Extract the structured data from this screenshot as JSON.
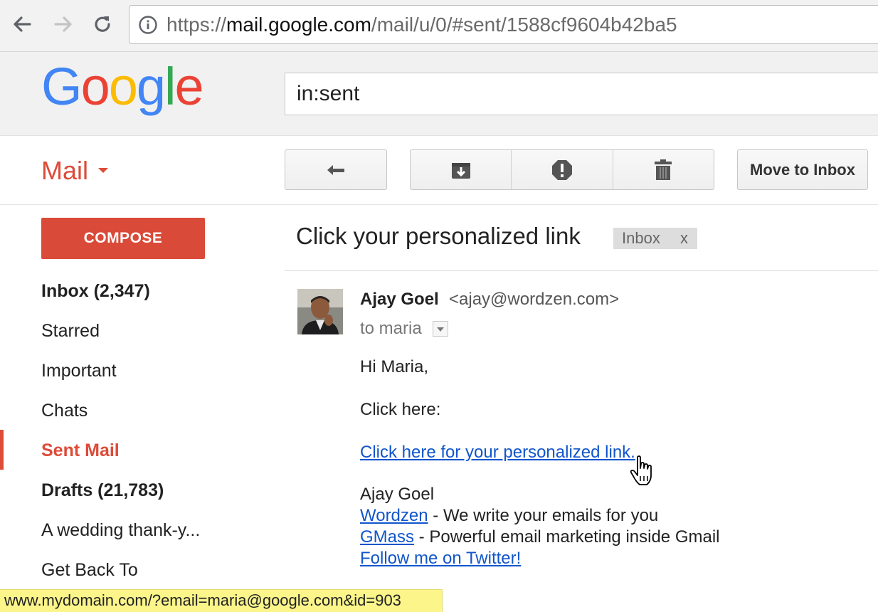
{
  "browser": {
    "url_prefix": "https://",
    "url_host": "mail.google.com",
    "url_path": "/mail/u/0/#sent/1588cf9604b42ba5"
  },
  "gmail": {
    "logo_letters": [
      {
        "ch": "G",
        "color": "#4285f4"
      },
      {
        "ch": "o",
        "color": "#ea4335"
      },
      {
        "ch": "o",
        "color": "#fbbc05"
      },
      {
        "ch": "g",
        "color": "#4285f4"
      },
      {
        "ch": "l",
        "color": "#34a853"
      },
      {
        "ch": "e",
        "color": "#ea4335"
      }
    ],
    "search_value": "in:sent",
    "app_label": "Mail"
  },
  "toolbar": {
    "reply_icon": "reply-icon",
    "archive_icon": "archive-icon",
    "spam_icon": "report-spam-icon",
    "delete_icon": "trash-icon",
    "move_label": "Move to Inbox"
  },
  "sidebar": {
    "compose_label": "COMPOSE",
    "items": [
      {
        "label": "Inbox (2,347)"
      },
      {
        "label": "Starred"
      },
      {
        "label": "Important"
      },
      {
        "label": "Chats"
      },
      {
        "label": "Sent Mail"
      },
      {
        "label": "Drafts (21,783)"
      },
      {
        "label": "A wedding thank-y..."
      },
      {
        "label": "Get Back To"
      }
    ]
  },
  "message": {
    "subject": "Click your personalized link",
    "label_chip": "Inbox",
    "label_remove": "x",
    "sender_name": "Ajay Goel",
    "sender_email": "<ajay@wordzen.com>",
    "to_line": "to maria",
    "greeting": "Hi Maria,",
    "click_here": "Click here:",
    "personal_link": "Click here for your personalized link.",
    "signature_name": "Ajay Goel",
    "sig_link1": "Wordzen",
    "sig_text1": " - We write your emails for you",
    "sig_link2": "GMass",
    "sig_text2": " - Powerful email marketing inside Gmail",
    "sig_link3": "Follow me on Twitter!"
  },
  "status_bar": {
    "hover_url": "www.mydomain.com/?email=maria@google.com&id=903"
  },
  "colors": {
    "accent_red": "#dd4b39",
    "compose_red": "#d94a38",
    "link_blue": "#1155cc",
    "status_yellow": "#fbf58a"
  }
}
